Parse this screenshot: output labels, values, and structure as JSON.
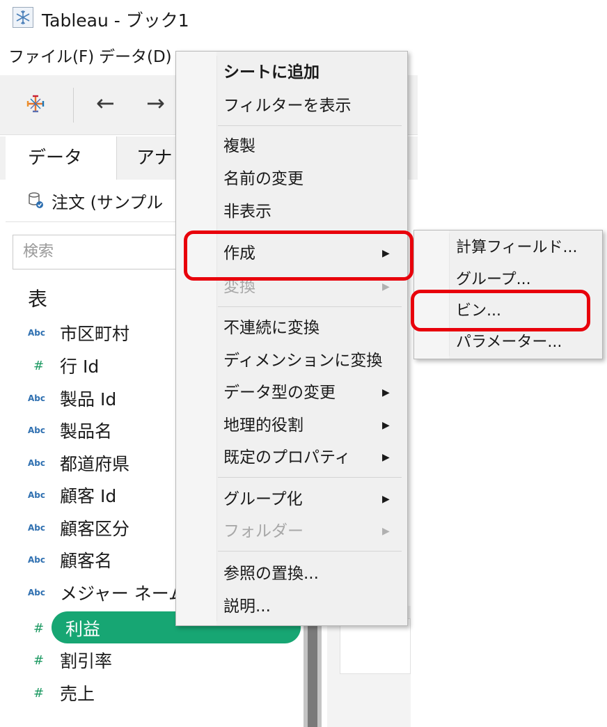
{
  "window": {
    "title": "Tableau - ブック1",
    "icon": "snowflake-icon"
  },
  "menubar": {
    "items": [
      "ファイル(F)",
      "データ(D)"
    ],
    "tail": "|"
  },
  "toolbar": {
    "logo_icon": "tableau-logo-icon",
    "back_glyph": "←",
    "forward_glyph": "→"
  },
  "data_pane": {
    "tabs": [
      "データ",
      "アナリ"
    ],
    "source": "注文 (サンプル",
    "search_placeholder": "検索",
    "section": "表",
    "fields": [
      {
        "type": "Abc",
        "name": "市区町村"
      },
      {
        "type": "#",
        "name": "行 Id"
      },
      {
        "type": "Abc",
        "name": "製品 Id"
      },
      {
        "type": "Abc",
        "name": "製品名"
      },
      {
        "type": "Abc",
        "name": "都道府県"
      },
      {
        "type": "Abc",
        "name": "顧客 Id"
      },
      {
        "type": "Abc",
        "name": "顧客区分"
      },
      {
        "type": "Abc",
        "name": "顧客名"
      },
      {
        "type": "Abc",
        "name": "メジャー ネーム"
      },
      {
        "type": "#",
        "name": "利益",
        "selected": true
      },
      {
        "type": "#",
        "name": "割引率"
      },
      {
        "type": "#",
        "name": "売上"
      }
    ]
  },
  "context_menu": {
    "items": [
      {
        "label": "シートに追加",
        "bold": true
      },
      {
        "label": "フィルターを表示"
      },
      {
        "label": "複製"
      },
      {
        "label": "名前の変更"
      },
      {
        "label": "非表示"
      },
      {
        "label": "作成",
        "submenu": true
      },
      {
        "label": "変換",
        "submenu": true,
        "disabled": true
      },
      {
        "label": "不連続に変換"
      },
      {
        "label": "ディメンションに変換"
      },
      {
        "label": "データ型の変更",
        "submenu": true
      },
      {
        "label": "地理的役割",
        "submenu": true
      },
      {
        "label": "既定のプロパティ",
        "submenu": true
      },
      {
        "label": "グループ化",
        "submenu": true
      },
      {
        "label": "フォルダー",
        "submenu": true,
        "disabled": true
      },
      {
        "label": "参照の置換..."
      },
      {
        "label": "説明..."
      }
    ],
    "arrow_glyph": "▶"
  },
  "create_submenu": {
    "items": [
      "計算フィールド...",
      "グループ...",
      "ビン...",
      "パラメーター..."
    ]
  },
  "colors": {
    "selected_pill": "#17a673",
    "highlight": "#e8000b",
    "abc_type": "#2e6fb0",
    "num_type": "#1e9a63"
  }
}
